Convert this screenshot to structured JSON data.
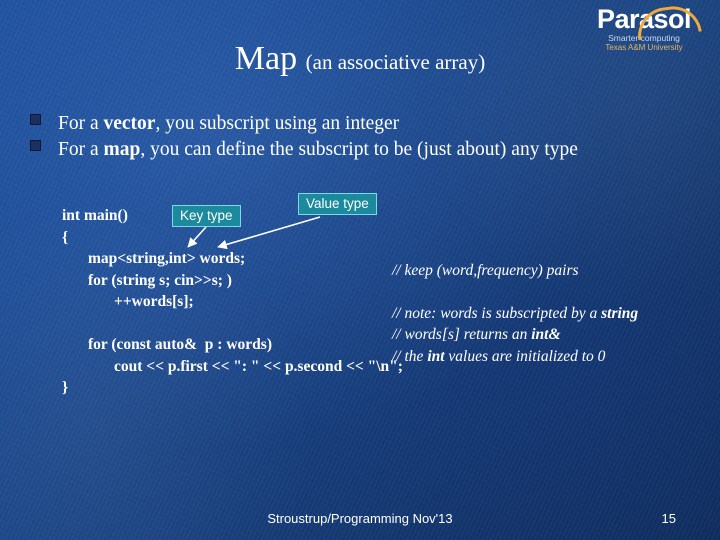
{
  "logo": {
    "word": "Parasol",
    "tagline": "Smarter computing",
    "org": "Texas A&M University",
    "arc": "orange-arc-icon"
  },
  "title": {
    "main": "Map ",
    "sub": "(an associative array)"
  },
  "bullets": [
    {
      "parts": [
        {
          "text": "For a ",
          "bold": false
        },
        {
          "text": "vector",
          "bold": true
        },
        {
          "text": ", you subscript using an integer",
          "bold": false
        }
      ]
    },
    {
      "parts": [
        {
          "text": "For a ",
          "bold": false
        },
        {
          "text": "map",
          "bold": true
        },
        {
          "text": ", you can define the subscript to be (just about) any type",
          "bold": false
        }
      ]
    }
  ],
  "code": {
    "lines": [
      {
        "text": "int main()",
        "indent": 0
      },
      {
        "text": "{",
        "indent": 0
      },
      {
        "text": "map<string,int> words;",
        "indent": 1
      },
      {
        "text": "for (string s; cin>>s; )",
        "indent": 1
      },
      {
        "text": "++words[s];",
        "indent": 2
      },
      {
        "text": "",
        "indent": 0
      },
      {
        "text": "for (const auto&  p : words)",
        "indent": 1
      },
      {
        "text": "cout << p.first << \": \" << p.second << \"\\n\";",
        "indent": 2
      },
      {
        "text": "}",
        "indent": 0
      }
    ]
  },
  "comments": [
    {
      "parts": [
        {
          "text": "// keep (word,frequency) pairs",
          "bold": false
        }
      ]
    },
    {
      "gap": true
    },
    {
      "parts": [
        {
          "text": "// note: words is subscripted by a ",
          "bold": false
        },
        {
          "text": "string",
          "bold": true
        }
      ]
    },
    {
      "parts": [
        {
          "text": "// words[s] returns an ",
          "bold": false
        },
        {
          "text": "int&",
          "bold": true
        }
      ]
    },
    {
      "parts": [
        {
          "text": "// the ",
          "bold": false
        },
        {
          "text": "int",
          "bold": true
        },
        {
          "text": " values are initialized to 0",
          "bold": false
        }
      ]
    }
  ],
  "callouts": {
    "key": "Key type",
    "value": "Value type"
  },
  "footer": {
    "text": "Stroustrup/Programming Nov'13",
    "page": "15"
  },
  "colors": {
    "background_start": "#1c4f9c",
    "background_end": "#0e2a57",
    "callout_fill": "#1a8a9c",
    "callout_border": "#7fd8e4",
    "logo_arc": "#f0a93a",
    "text": "#ffffff"
  }
}
